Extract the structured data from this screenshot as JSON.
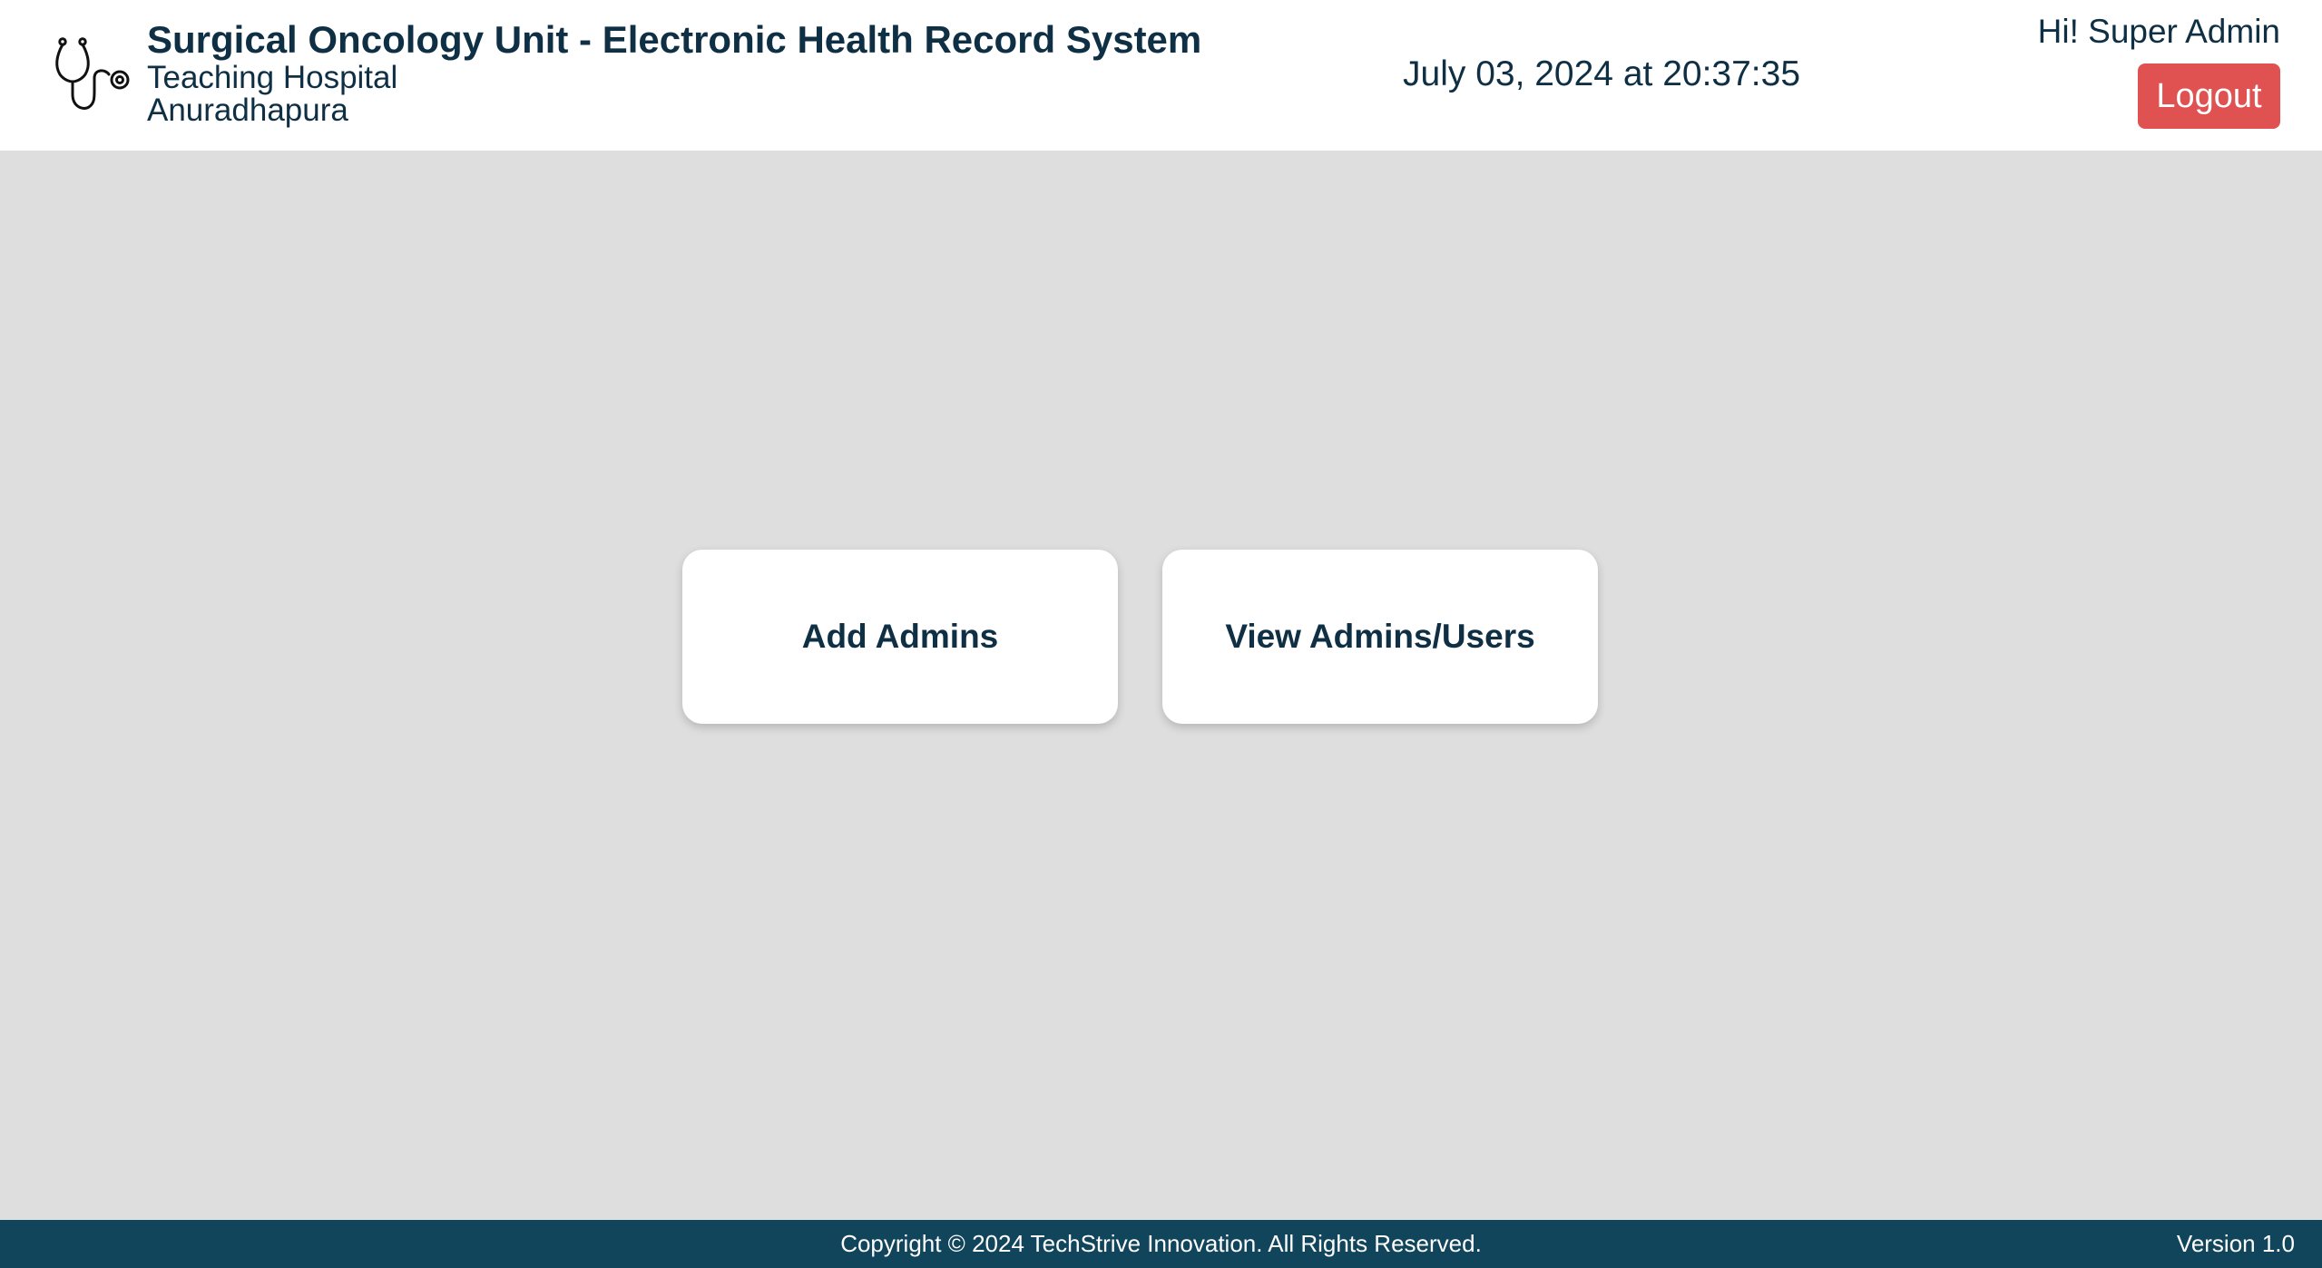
{
  "header": {
    "title": "Surgical Oncology Unit - Electronic Health Record System",
    "subtitle_line1": "Teaching Hospital",
    "subtitle_line2": "Anuradhapura",
    "logo_icon": "stethoscope-icon",
    "datetime": "July 03, 2024 at 20:37:35",
    "greeting": "Hi! Super Admin",
    "logout_label": "Logout"
  },
  "main": {
    "cards": [
      {
        "label": "Add Admins"
      },
      {
        "label": "View Admins/Users"
      }
    ]
  },
  "footer": {
    "copyright": "Copyright © 2024 TechStrive Innovation. All Rights Reserved.",
    "version": "Version 1.0"
  },
  "colors": {
    "header_bg": "#ffffff",
    "page_bg": "#dedede",
    "text_primary": "#0e2f44",
    "logout_bg": "#e05252",
    "footer_bg": "#11455c"
  }
}
